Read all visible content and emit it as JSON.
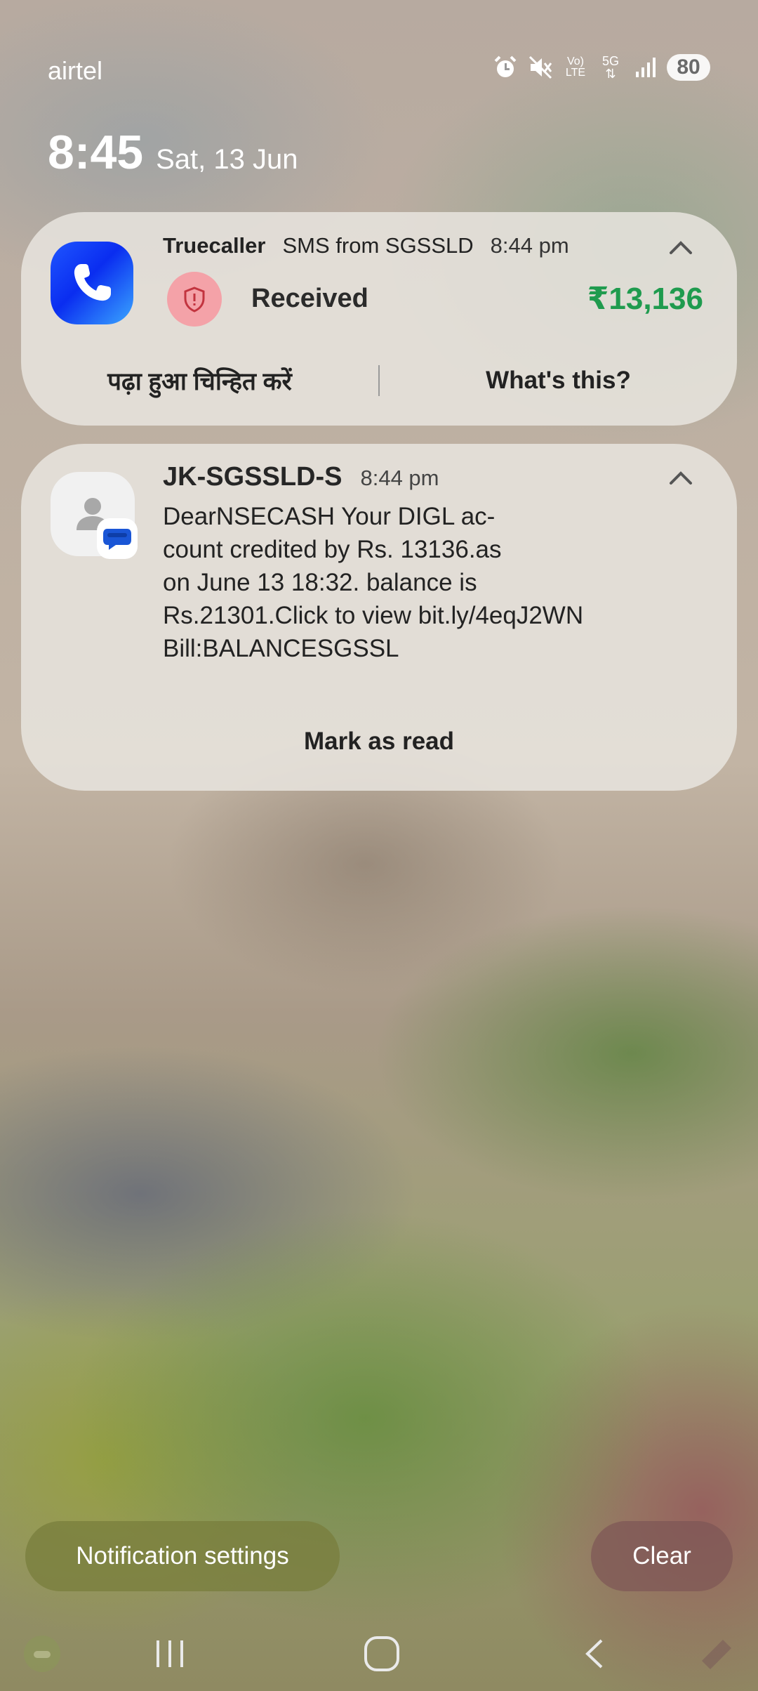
{
  "status_bar": {
    "carrier": "airtel",
    "battery": "80",
    "icons": [
      "alarm-icon",
      "mute-icon",
      "volte-icon",
      "5g-icon",
      "signal-icon"
    ],
    "volte_label_top": "Vo)",
    "volte_label_bottom": "LTE",
    "net_label": "5G"
  },
  "lock_clock": {
    "time": "8:45",
    "date": "Sat, 13 Jun"
  },
  "notifications": [
    {
      "app": "Truecaller",
      "source": "SMS from SGSSLD",
      "time": "8:44 pm",
      "status": "Received",
      "amount": "₹13,136",
      "actions": [
        "पढ़ा हुआ चिन्हित करें",
        "What's this?"
      ]
    },
    {
      "sender": "JK-SGSSLD-S",
      "time": "8:44 pm",
      "body_lines": [
        "DearNSECASH Your DIGL ac-",
        "count credited by Rs. 13136.as",
        "on June 13 18:32. balance is",
        "Rs.21301.Click to view bit.ly/4eqJ2WN",
        "Bill:BALANCESGSSL"
      ],
      "action": "Mark as read"
    }
  ],
  "footer": {
    "settings_label": "Notification settings",
    "clear_label": "Clear"
  },
  "colors": {
    "amount_green": "#1f9b4e",
    "truecaller_blue": "#0a2df0",
    "shield_bg": "#f4a2a8"
  }
}
